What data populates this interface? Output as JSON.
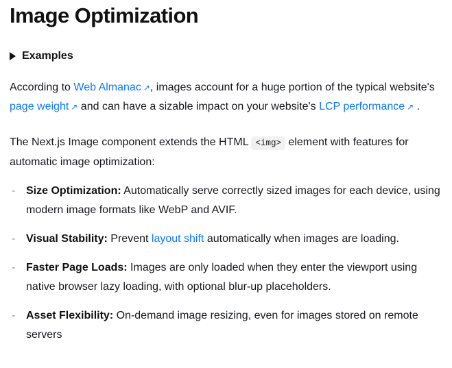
{
  "page": {
    "title": "Image Optimization"
  },
  "disclosure": {
    "marker_icon": "triangle-right-icon",
    "label": "Examples"
  },
  "paragraph_almanac": {
    "text_1": "According to ",
    "link_1": "Web Almanac",
    "arrow_1": "↗",
    "text_2": ", images account for a huge portion of the typical website's ",
    "link_2": "page weight",
    "arrow_2": "↗",
    "text_3": " and can have a sizable impact on your website's ",
    "link_3": "LCP performance",
    "arrow_3": "↗",
    "text_4": " ."
  },
  "paragraph_component": {
    "text_1": "The Next.js Image component extends the HTML ",
    "code": "<img>",
    "text_2": " element with features for automatic image optimization:"
  },
  "features": {
    "marker": "-",
    "items": [
      {
        "lead": "Size Optimization:",
        "text_1": " Automatically serve correctly sized images for each device, using modern image formats like WebP and AVIF."
      },
      {
        "lead": "Visual Stability:",
        "text_1": " Prevent ",
        "link": "layout shift",
        "text_2": " automatically when images are loading."
      },
      {
        "lead": "Faster Page Loads:",
        "text_1": " Images are only loaded when they enter the viewport using native browser lazy loading, with optional blur-up placeholders."
      },
      {
        "lead": "Asset Flexibility:",
        "text_1": " On-demand image resizing, even for images stored on remote servers"
      }
    ]
  },
  "colors": {
    "link": "#0f7bf4",
    "text": "#16181d",
    "heading": "#111111",
    "marker": "#8a8f98",
    "code_bg": "#f1f1f1",
    "background": "#ffffff"
  }
}
